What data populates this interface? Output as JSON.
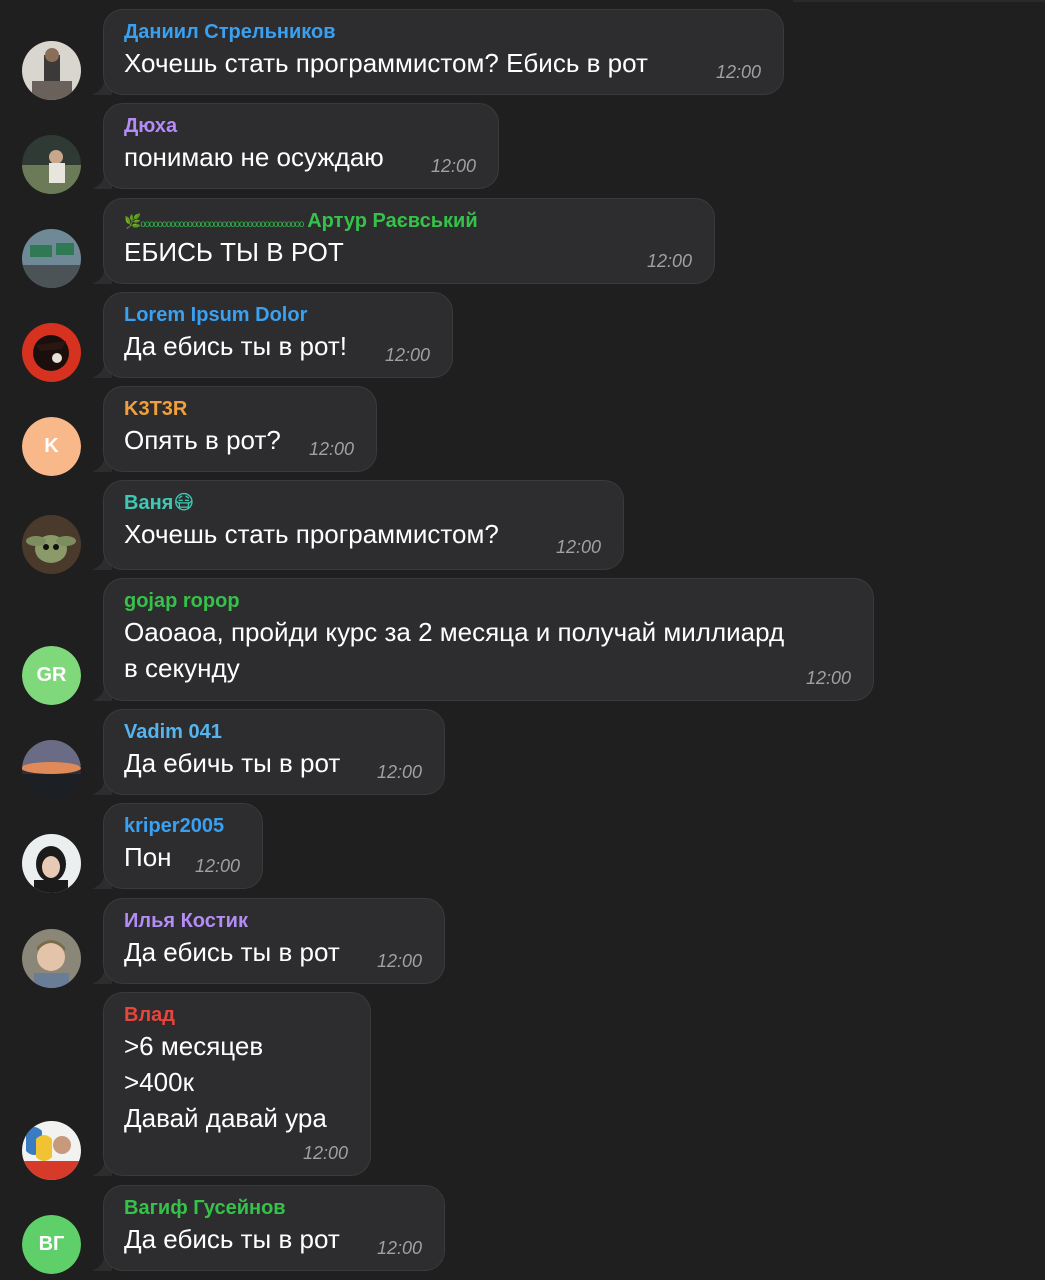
{
  "messages": [
    {
      "sender": "Даниил Стрельников",
      "sender_color": "#3aa0f0",
      "lines": [
        "Хочешь стать программистом? Ебись в рот"
      ],
      "time": "12:00",
      "avatar": "photo"
    },
    {
      "sender": "Дюха",
      "sender_color": "#b38cf5",
      "lines": [
        "понимаю не осуждаю"
      ],
      "time": "12:00",
      "avatar": "photo"
    },
    {
      "sender": "Артур Раєвський",
      "sender_color": "#36c14a",
      "sender_prefix": "🌿ₒₒₒₒₒₒₒₒₒₒₒₒₒₒₒₒₒₒₒₒₒₒₒₒₒₒₒₒₒₒₒₒₒₒₒₒₒₒ",
      "lines": [
        "ЕБИСЬ ТЫ В РОТ"
      ],
      "time": "12:00",
      "avatar": "photo"
    },
    {
      "sender": "Lorem Ipsum Dolor",
      "sender_color": "#3aa0f0",
      "lines": [
        "Да ебись ты в рот!"
      ],
      "time": "12:00",
      "avatar": "photo"
    },
    {
      "sender": "K3T3R",
      "sender_color": "#f2a03c",
      "lines": [
        "Опять в рот?"
      ],
      "time": "12:00",
      "avatar": "initials",
      "initials": "K",
      "avatar_color": "#f8b88a"
    },
    {
      "sender": "Ваня😷",
      "sender_color": "#3ec9b5",
      "lines": [
        "Хочешь стать программистом?"
      ],
      "time": "12:00",
      "avatar": "photo"
    },
    {
      "sender": "gojap ropop",
      "sender_color": "#36c14a",
      "lines": [
        "Оаоаоа, пройди курс за 2 месяца и получай миллиард",
        "в секунду"
      ],
      "time": "12:00",
      "avatar": "initials",
      "initials": "GR",
      "avatar_color": "#7fd87a"
    },
    {
      "sender": "Vadim 041",
      "sender_color": "#55b5ee",
      "lines": [
        "Да ебичь ты в рот"
      ],
      "time": "12:00",
      "avatar": "photo"
    },
    {
      "sender": "kriper2005",
      "sender_color": "#3aa0f0",
      "lines": [
        "Пон"
      ],
      "time": "12:00",
      "avatar": "photo"
    },
    {
      "sender": "Илья Костик",
      "sender_color": "#b38cf5",
      "lines": [
        "Да ебись ты в рот"
      ],
      "time": "12:00",
      "avatar": "photo"
    },
    {
      "sender": "Влад",
      "sender_color": "#e8453c",
      "lines": [
        ">6 месяцев",
        ">400к",
        "Давай давай ура"
      ],
      "time": "12:00",
      "avatar": "photo"
    },
    {
      "sender": "Вагиф Гусейнов",
      "sender_color": "#36c14a",
      "lines": [
        "Да ебись ты в рот"
      ],
      "time": "12:00",
      "avatar": "initials",
      "initials": "ВГ",
      "avatar_color": "#5fcf6a"
    }
  ]
}
